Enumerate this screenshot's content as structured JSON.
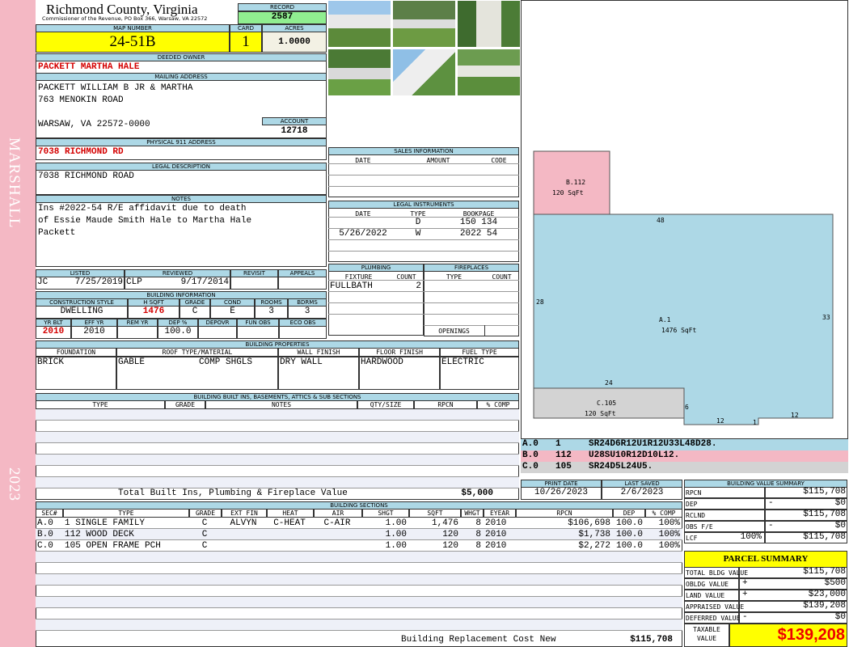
{
  "side": {
    "name": "MARSHALL",
    "year": "2023"
  },
  "header": {
    "title": "Richmond County, Virginia",
    "subtitle": "Commissioner of the Revenue, PO Box 366, Warsaw, VA 22572",
    "record_label": "RECORD",
    "record": "2587",
    "map_label": "MAP NUMBER",
    "map": "24-51B",
    "card_label": "CARD",
    "card": "1",
    "acres_label": "ACRES",
    "acres": "1.0000"
  },
  "owner": {
    "label": "DEEDED OWNER",
    "value": "PACKETT MARTHA HALE"
  },
  "mailing": {
    "label": "MAILING ADDRESS",
    "line1": "PACKETT WILLIAM B JR & MARTHA",
    "line2": "763 MENOKIN ROAD",
    "line3": "WARSAW, VA 22572-0000",
    "account_label": "ACCOUNT",
    "account": "12718"
  },
  "physical": {
    "label": "PHYSICAL 911 ADDRESS",
    "value": "7038 RICHMOND RD"
  },
  "legal": {
    "label": "LEGAL DESCRIPTION",
    "value": "7038 RICHMOND ROAD"
  },
  "notes": {
    "label": "NOTES",
    "lines": [
      "Ins #2022-54 R/E affidavit due to death",
      "of Essie Maude Smith Hale to Martha Hale",
      "Packett"
    ]
  },
  "review": {
    "listed_label": "LISTED",
    "listed_by": "JC",
    "listed_date": "7/25/2019",
    "reviewed_label": "REVIEWED",
    "reviewed_by": "CLP",
    "reviewed_date": "9/17/2014",
    "revisit_label": "REVISIT",
    "appeals_label": "APPEALS"
  },
  "bldg_info": {
    "label": "BUILDING INFORMATION",
    "h1": [
      "CONSTRUCTION STYLE",
      "H SQFT",
      "GRADE",
      "COND",
      "ROOMS",
      "BDRMS"
    ],
    "v1": [
      "DWELLING",
      "1476",
      "C",
      "E",
      "3",
      "3"
    ],
    "h2": [
      "YR BLT",
      "EFF YR",
      "REM YR",
      "DEP %",
      "DEPOVR",
      "FUN OBS",
      "ECO OBS"
    ],
    "v2": [
      "2010",
      "2010",
      "",
      "100.0",
      "",
      "",
      ""
    ]
  },
  "sales": {
    "label": "SALES INFORMATION",
    "cols": [
      "DATE",
      "AMOUNT",
      "CODE"
    ]
  },
  "instruments": {
    "label": "LEGAL INSTRUMENTS",
    "cols": [
      "DATE",
      "TYPE",
      "BOOKPAGE"
    ],
    "rows": [
      [
        "",
        "D",
        "150 134"
      ],
      [
        "5/26/2022",
        "W",
        "2022 54"
      ]
    ]
  },
  "plumbing": {
    "label": "PLUMBING",
    "cols": [
      "FIXTURE",
      "COUNT"
    ],
    "rows": [
      [
        "FULLBATH",
        "2"
      ]
    ]
  },
  "fireplaces": {
    "label": "FIREPLACES",
    "cols": [
      "TYPE",
      "COUNT"
    ],
    "openings_label": "OPENINGS"
  },
  "properties": {
    "label": "BUILDING PROPERTIES",
    "cols": [
      "FOUNDATION",
      "ROOF TYPE/MATERIAL",
      "WALL FINISH",
      "FLOOR FINISH",
      "FUEL TYPE"
    ],
    "foundation": "BRICK",
    "roof_type": "GABLE",
    "roof_material": "COMP SHGLS",
    "wall": "DRY WALL",
    "floor": "HARDWOOD",
    "fuel": "ELECTRIC"
  },
  "builtins": {
    "label": "BUILDING BUILT INS, BASEMENTS, ATTICS & SUB SECTIONS",
    "cols": [
      "TYPE",
      "GRADE",
      "NOTES",
      "QTY/SIZE",
      "RPCN",
      "% COMP"
    ],
    "total_label": "Total Built Ins, Plumbing & Fireplace Value",
    "total": "$5,000"
  },
  "sketch": {
    "labels": {
      "b": "B.112",
      "b_area": "120 SqFt",
      "a": "A.1",
      "a_area": "1476 SqFt",
      "c": "C.105",
      "c_area": "120 SqFt"
    },
    "dims": {
      "top": "48",
      "left": "28",
      "right": "33",
      "bottom_left": "24",
      "c_right": "6",
      "step1": "12",
      "step2": "1",
      "step3": "12"
    },
    "codes": [
      {
        "sec": "A.0",
        "num": "1",
        "code": "SR24D6R12U1R12U33L48D28."
      },
      {
        "sec": "B.0",
        "num": "112",
        "code": "U28SU10R12D10L12."
      },
      {
        "sec": "C.0",
        "num": "105",
        "code": "SR24D5L24U5."
      }
    ]
  },
  "dates": {
    "print_label": "PRINT DATE",
    "print": "10/26/2023",
    "saved_label": "LAST SAVED",
    "saved": "2/6/2023"
  },
  "sections": {
    "label": "BUILDING SECTIONS",
    "cols": [
      "SEC#",
      "TYPE",
      "GRADE",
      "EXT FIN",
      "HEAT",
      "AIR",
      "SHGT",
      "SQFT",
      "WHGT",
      "EYEAR",
      "RPCN",
      "DEP",
      "% COMP"
    ],
    "rows": [
      [
        "A.0",
        "1 SINGLE FAMILY",
        "C",
        "ALVYN",
        "C-HEAT",
        "C-AIR",
        "1.00",
        "1,476",
        "8",
        "2010",
        "$106,698",
        "100.0",
        "100%"
      ],
      [
        "B.0",
        "112 WOOD DECK",
        "C",
        "",
        "",
        "",
        "1.00",
        "120",
        "8",
        "2010",
        "$1,738",
        "100.0",
        "100%"
      ],
      [
        "C.0",
        "105 OPEN FRAME PCH",
        "C",
        "",
        "",
        "",
        "1.00",
        "120",
        "8",
        "2010",
        "$2,272",
        "100.0",
        "100%"
      ]
    ],
    "footer_label": "Building Replacement Cost New",
    "footer_value": "$115,708"
  },
  "value_summary": {
    "label": "BUILDING VALUE SUMMARY",
    "rpcn_label": "RPCN",
    "rpcn": "$115,708",
    "dep_label": "DEP",
    "dep_sign": "-",
    "dep": "$0",
    "rclnd_label": "RCLND",
    "rclnd": "$115,708",
    "obs_label": "OBS F/E",
    "obs_sign": "-",
    "obs": "$0",
    "lcf_label": "LCF",
    "lcf_pct": "100%",
    "lcf": "$115,708"
  },
  "parcel": {
    "label": "PARCEL SUMMARY",
    "total_label": "TOTAL BLDG VALUE",
    "total": "$115,708",
    "obldg_label": "OBLDG VALUE",
    "obldg_sign": "+",
    "obldg": "$500",
    "land_label": "LAND VALUE",
    "land_sign": "+",
    "land": "$23,000",
    "appraised_label": "APPRAISED VALUE",
    "appraised": "$139,208",
    "deferred_label": "DEFERRED VALUE",
    "deferred_sign": "-",
    "deferred": "$0",
    "taxable_label1": "TAXABLE",
    "taxable_label2": "VALUE",
    "taxable": "$139,208"
  },
  "colors": {
    "header": "#add8e6",
    "yellow": "#ffff00",
    "record": "#90ee90",
    "sketch_a": "#add8e6",
    "sketch_b": "#f4b8c4",
    "sketch_c": "#d3d3d3",
    "red": "#d40000"
  }
}
